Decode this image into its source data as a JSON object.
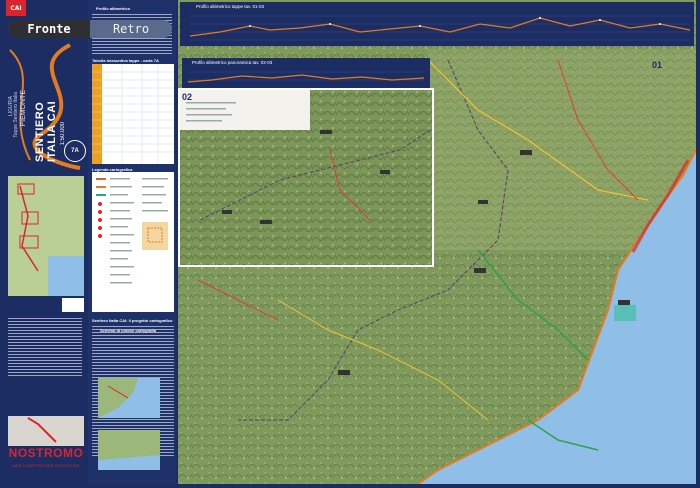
{
  "tabs": {
    "front_label": "Fronte",
    "back_label": "Retro",
    "active": "front"
  },
  "cover": {
    "brand": "SENTIERO ITALIA CAI",
    "region": "PIEMONTE",
    "sub1": "LIGURIA",
    "sub2": "Tappe Sentiero Italia",
    "scale": "1:50.000",
    "sheet": "7A"
  },
  "info": {
    "profile_header": "Profilo altimetrico",
    "table_header": "Tabella riassuntiva tappe - carta 7A",
    "legend_header": "Legenda cartografica",
    "section_header": "Sentiero Italia CAI: Il progetto cartografico",
    "scheme_header": "Schema di unione cartografia"
  },
  "map": {
    "profile1_title": "Profilo altimetrico tappe tav. 01-03",
    "profile2_title": "Profilo altimetrico panoramica tav. 02-03",
    "inset_number": "02",
    "main_number": "01"
  },
  "watermark": {
    "title": "NOSTROMO",
    "subtitle": "WEB COMPTOIR DES VOYAGEURS"
  },
  "colors": {
    "navy": "#1c2d63",
    "sea": "#8fbfe6",
    "forest": "#6b8a4d",
    "accent": "#d9262c"
  }
}
